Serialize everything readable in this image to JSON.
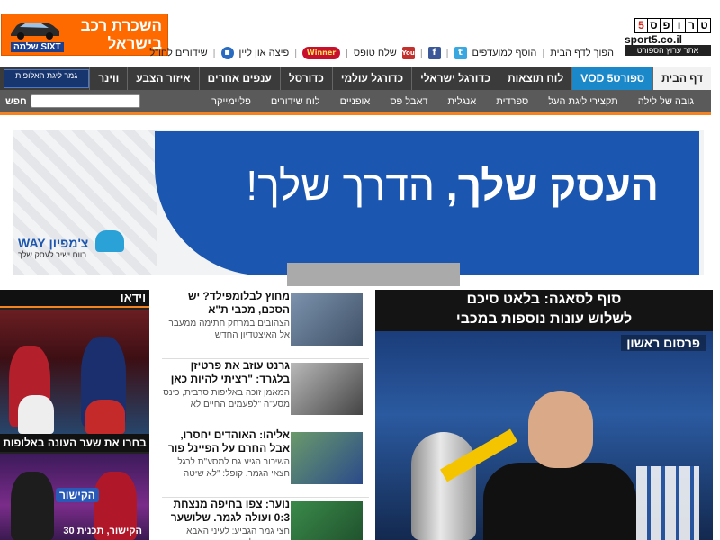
{
  "ad_top": {
    "line1": "השכרת רכב",
    "line2": "בישראל",
    "brand": "שלמה SIXT"
  },
  "logo": {
    "letters": [
      "5",
      "ס",
      "פ",
      "ו",
      "ר",
      "ט"
    ],
    "url": "sport5.co.il",
    "tagline": "אתר ערוץ הספורט"
  },
  "toplinks": {
    "home": "הפוך לדף הבית",
    "favorites": "הוסף למועדפים",
    "tofes": "שלח טופס",
    "pizza": "פיצה און ליין",
    "live": "שידורים לחו\"ל",
    "winner_logo": "Winner"
  },
  "nav": {
    "items": [
      "דף הבית",
      "ספורט5 VOD",
      "לוח תוצאות",
      "כדורגל ישראלי",
      "כדורגל עולמי",
      "כדורסל",
      "ענפים אחרים",
      "איזור הצבע",
      "ווינר"
    ],
    "promo": "גמר ליגת האלופות"
  },
  "subnav": {
    "items": [
      "גובה של לילה",
      "תקצירי ליגת העל",
      "ספרדית",
      "אנגלית",
      "דאבל פס",
      "אופניים",
      "לוח שידורים",
      "פליימייקר"
    ],
    "search_button": "חפש"
  },
  "banner": {
    "headline_bold": "העסק שלך,",
    "headline_light": "הדרך שלך!",
    "brand": "צ'מפיון WAY",
    "brand_sub": "רווח ישיר לעסק שלך"
  },
  "video": {
    "header": "וידאו",
    "caption1": "בחרו את שער העונה באלופות",
    "logo2": "הקישור",
    "caption2": "הקישור, תכנית 30"
  },
  "news": [
    {
      "title": "מחוץ לבלומפילד? יש הסכם, מכבי ת\"א",
      "summary": "הצהובים במרחק חתימה ממעבר אל האיצטדיון החדש"
    },
    {
      "title": "גרנט עוזב את פרטיזן בלגרד: \"רציתי להיות כאן",
      "summary": "המאמן זוכה באליפות סרבית, כינס מסע\"ה \"לפעמים החיים לא"
    },
    {
      "title": "אליהו: האוהדים יחסרו, אבל החרם על הפיינל פור",
      "summary": "השיכור הגיע גם למסע\"ת לרגל חצאי הגמר. קופל: \"לא שיטה"
    },
    {
      "title": "נוער: צפו בחיפה מנצחת 0:3 ועולה לגמר. שלושער",
      "summary": "חצי גמר הגביע: לעיני האבא ואמא, הבלוגר הקטן עשה"
    }
  ],
  "main_story": {
    "title_line1": "סוף לסאגה: בלאט סיכם",
    "title_line2": "לשלוש עונות נוספות במכבי",
    "label": "פרסום ראשון"
  }
}
